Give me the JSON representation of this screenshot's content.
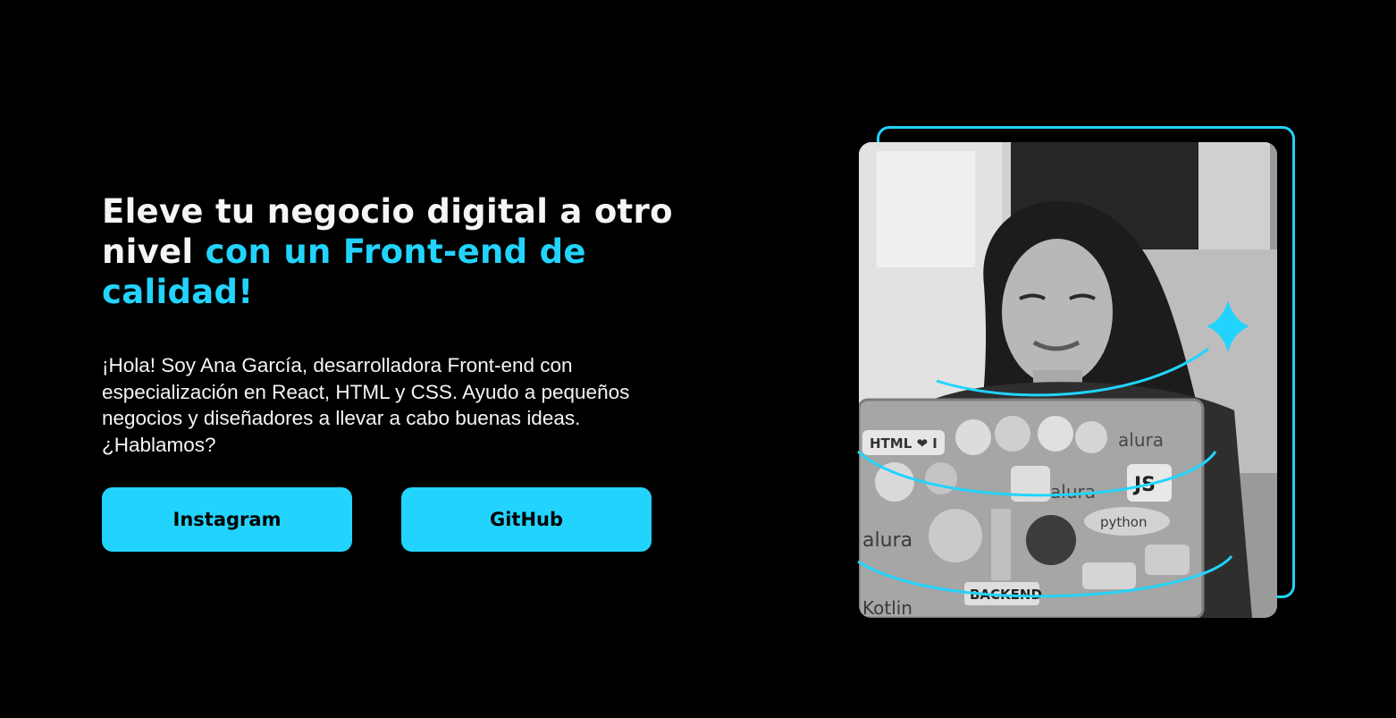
{
  "hero": {
    "title_main": "Eleve tu negocio digital a otro nivel ",
    "title_accent": "con un Front-end de calidad!",
    "intro": "¡Hola! Soy Ana García, desarrolladora Front-end con especialización en React, HTML y CSS. Ayudo a pequeños negocios y diseñadores a llevar a cabo buenas ideas. ¿Hablamos?"
  },
  "buttons": {
    "instagram": "Instagram",
    "github": "GitHub"
  },
  "photo": {
    "laptop_stickers": [
      "HTML ❤ I",
      "alura",
      "JS",
      "alura",
      "python",
      "alura",
      "BACKEND",
      "Kotlin"
    ]
  },
  "colors": {
    "background": "#000000",
    "text": "#F5F5F5",
    "accent": "#22D4FD",
    "button_text": "#000000"
  },
  "icons": {
    "decoration": "sparkle-icon"
  }
}
